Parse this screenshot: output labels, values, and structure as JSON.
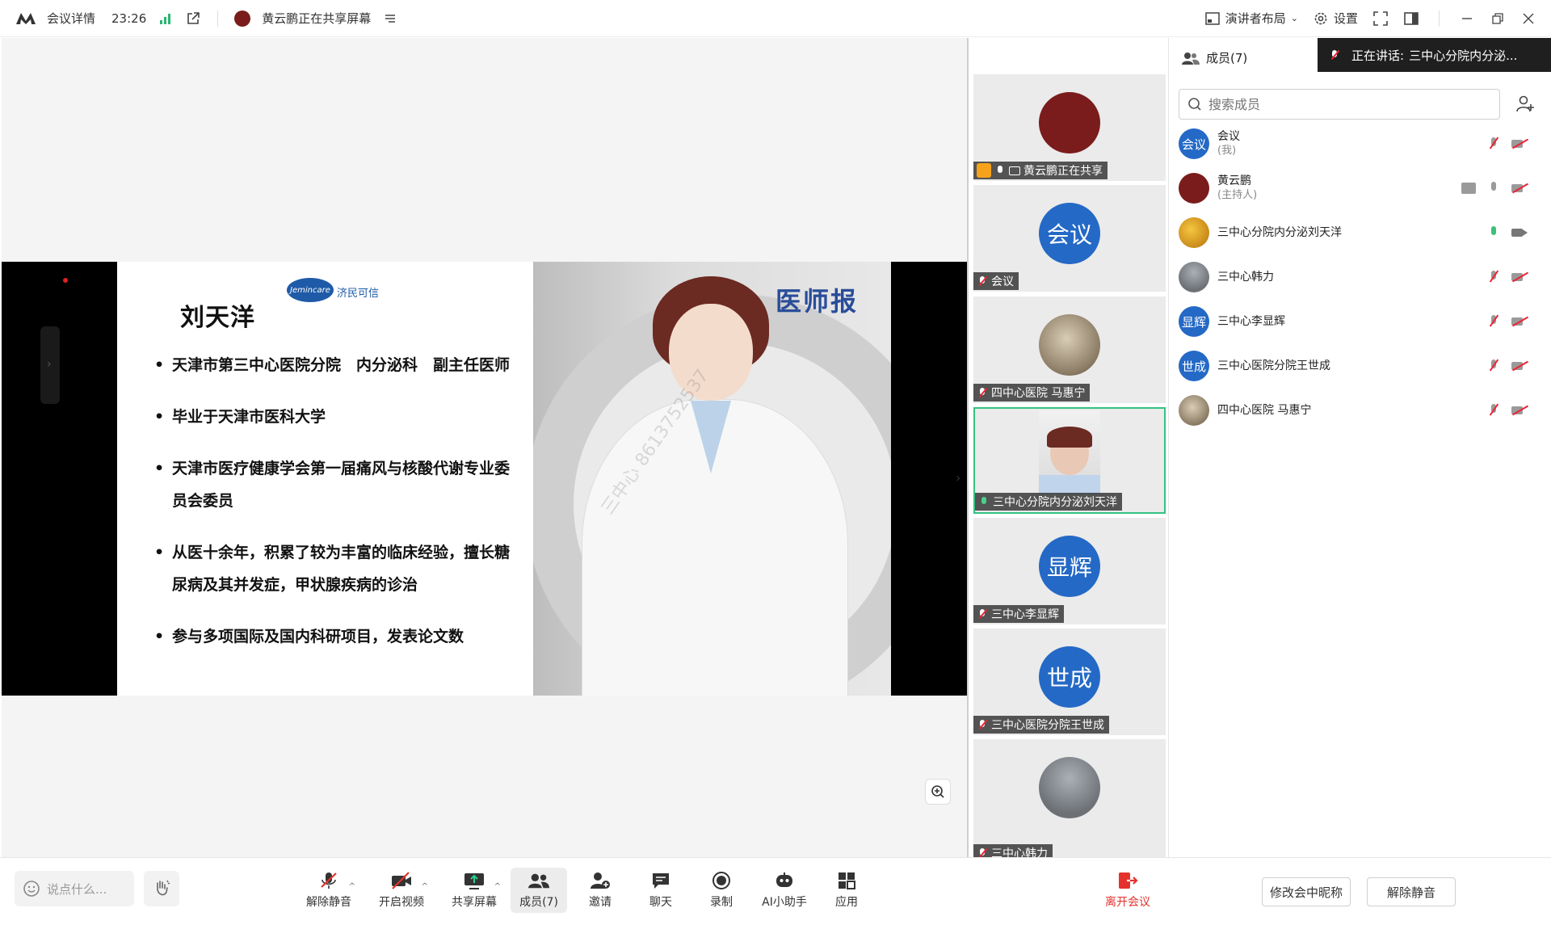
{
  "topbar": {
    "meeting_details": "会议详情",
    "time": "23:26",
    "sharing_text": "黄云鹏正在共享屏幕",
    "layout_label": "演讲者布局",
    "settings_label": "设置"
  },
  "slide": {
    "name": "刘天洋",
    "logo_text": "Jemincare",
    "logo_cn": "济民可信",
    "corner_mark": "医师报",
    "bullets": [
      "天津市第三中心医院分院　内分泌科　副主任医师",
      "毕业于天津市医科大学",
      "天津市医疗健康学会第一届痛风与核酸代谢专业委员会委员",
      "从医十余年，积累了较为丰富的临床经验，擅长糖尿病及其并发症，甲状腺疾病的诊治",
      "参与多项国际及国内科研项目，发表论文数"
    ],
    "watermark": "三中心 8613752537"
  },
  "tiles": [
    {
      "label": "黄云鹏正在共享",
      "avatar_text": "",
      "avatar_color": "#7a1c1c"
    },
    {
      "label": "会议",
      "avatar_text": "会议",
      "avatar_color": "#2469c6"
    },
    {
      "label": "四中心医院 马惠宁",
      "avatar_text": "",
      "avatar_color": "#9b8b74"
    },
    {
      "label": "三中心分院内分泌刘天洋",
      "avatar_text": "",
      "avatar_color": "#e9d9cf"
    },
    {
      "label": "三中心李显辉",
      "avatar_text": "显辉",
      "avatar_color": "#2469c6"
    },
    {
      "label": "三中心医院分院王世成",
      "avatar_text": "世成",
      "avatar_color": "#2469c6"
    },
    {
      "label": "三中心韩力",
      "avatar_text": "",
      "avatar_color": "#7d8084"
    }
  ],
  "panel": {
    "title": "成员(7)",
    "speaking_label": "正在讲话:",
    "speaking_name": "三中心分院内分泌...",
    "search_placeholder": "搜索成员",
    "members": [
      {
        "name": "会议",
        "sub": "(我)",
        "avatar_text": "会议",
        "avatar_color": "#2469c6"
      },
      {
        "name": "黄云鹏",
        "sub": "(主持人)",
        "avatar_text": "",
        "avatar_color": "#7a1c1c"
      },
      {
        "name": "三中心分院内分泌刘天洋",
        "sub": "",
        "avatar_text": "",
        "avatar_color": "#e0a526"
      },
      {
        "name": "三中心韩力",
        "sub": "",
        "avatar_text": "",
        "avatar_color": "#7d8084"
      },
      {
        "name": "三中心李显辉",
        "sub": "",
        "avatar_text": "显辉",
        "avatar_color": "#2469c6"
      },
      {
        "name": "三中心医院分院王世成",
        "sub": "",
        "avatar_text": "世成",
        "avatar_color": "#2469c6"
      },
      {
        "name": "四中心医院 马惠宁",
        "sub": "",
        "avatar_text": "",
        "avatar_color": "#9b8b74"
      }
    ],
    "rename_button": "修改会中昵称",
    "unmute_all_button": "解除静音"
  },
  "toolbar": {
    "say_placeholder": "说点什么...",
    "unmute": "解除静音",
    "start_video": "开启视频",
    "share_screen": "共享屏幕",
    "members": "成员(7)",
    "invite": "邀请",
    "chat": "聊天",
    "record": "录制",
    "ai_assistant": "AI小助手",
    "apps": "应用",
    "leave": "离开会议"
  }
}
